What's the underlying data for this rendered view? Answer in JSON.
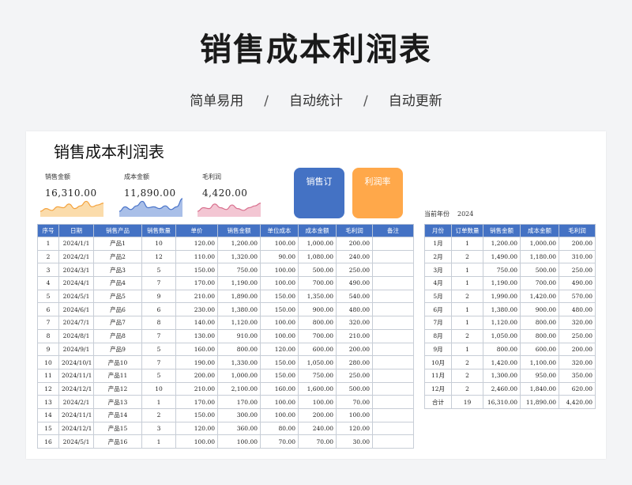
{
  "header": {
    "title": "销售成本利润表",
    "tags": [
      "简单易用",
      "自动统计",
      "自动更新"
    ],
    "separator": "/"
  },
  "sheet": {
    "title": "销售成本利润表",
    "kpis": [
      {
        "label": "销售金额",
        "value": "16,310.00",
        "color": "#f4a23c",
        "fill": "#fbdcab",
        "trend": [
          0.3,
          0.45,
          0.35,
          0.55,
          0.5,
          0.7,
          0.45,
          0.6,
          0.85,
          0.55,
          0.65,
          0.75
        ]
      },
      {
        "label": "成本金额",
        "value": "11,890.00",
        "color": "#4a74c9",
        "fill": "#a9bfe8",
        "trend": [
          0.3,
          0.55,
          0.4,
          0.6,
          0.85,
          0.5,
          0.55,
          0.45,
          0.6,
          0.4,
          0.55,
          1.0
        ]
      },
      {
        "label": "毛利润",
        "value": "4,420.00",
        "color": "#d8708e",
        "fill": "#f3c6d3",
        "trend": [
          0.3,
          0.5,
          0.45,
          0.7,
          0.5,
          0.4,
          0.65,
          0.45,
          0.35,
          0.5,
          0.6,
          0.75
        ]
      }
    ],
    "tiles": [
      {
        "label": "销售订",
        "color": "#4472c4"
      },
      {
        "label": "利润率",
        "color": "#ffa84a"
      }
    ],
    "year_label": "当前年份",
    "year_value": "2024"
  },
  "detail_table": {
    "headers": [
      "序号",
      "日期",
      "销售产品",
      "销售数量",
      "单价",
      "销售金额",
      "单位成本",
      "成本金额",
      "毛利润",
      "备注"
    ],
    "rows": [
      [
        "1",
        "2024/1/1",
        "产品1",
        "10",
        "120.00",
        "1,200.00",
        "100.00",
        "1,000.00",
        "200.00",
        ""
      ],
      [
        "2",
        "2024/2/1",
        "产品2",
        "12",
        "110.00",
        "1,320.00",
        "90.00",
        "1,080.00",
        "240.00",
        ""
      ],
      [
        "3",
        "2024/3/1",
        "产品3",
        "5",
        "150.00",
        "750.00",
        "100.00",
        "500.00",
        "250.00",
        ""
      ],
      [
        "4",
        "2024/4/1",
        "产品4",
        "7",
        "170.00",
        "1,190.00",
        "100.00",
        "700.00",
        "490.00",
        ""
      ],
      [
        "5",
        "2024/5/1",
        "产品5",
        "9",
        "210.00",
        "1,890.00",
        "150.00",
        "1,350.00",
        "540.00",
        ""
      ],
      [
        "6",
        "2024/6/1",
        "产品6",
        "6",
        "230.00",
        "1,380.00",
        "150.00",
        "900.00",
        "480.00",
        ""
      ],
      [
        "7",
        "2024/7/1",
        "产品7",
        "8",
        "140.00",
        "1,120.00",
        "100.00",
        "800.00",
        "320.00",
        ""
      ],
      [
        "8",
        "2024/8/1",
        "产品8",
        "7",
        "130.00",
        "910.00",
        "100.00",
        "700.00",
        "210.00",
        ""
      ],
      [
        "9",
        "2024/9/1",
        "产品9",
        "5",
        "160.00",
        "800.00",
        "120.00",
        "600.00",
        "200.00",
        ""
      ],
      [
        "10",
        "2024/10/1",
        "产品10",
        "7",
        "190.00",
        "1,330.00",
        "150.00",
        "1,050.00",
        "280.00",
        ""
      ],
      [
        "11",
        "2024/11/1",
        "产品11",
        "5",
        "200.00",
        "1,000.00",
        "150.00",
        "750.00",
        "250.00",
        ""
      ],
      [
        "12",
        "2024/12/1",
        "产品12",
        "10",
        "210.00",
        "2,100.00",
        "160.00",
        "1,600.00",
        "500.00",
        ""
      ],
      [
        "13",
        "2024/2/1",
        "产品13",
        "1",
        "170.00",
        "170.00",
        "100.00",
        "100.00",
        "70.00",
        ""
      ],
      [
        "14",
        "2024/11/1",
        "产品14",
        "2",
        "150.00",
        "300.00",
        "100.00",
        "200.00",
        "100.00",
        ""
      ],
      [
        "15",
        "2024/12/1",
        "产品15",
        "3",
        "120.00",
        "360.00",
        "80.00",
        "240.00",
        "120.00",
        ""
      ],
      [
        "16",
        "2024/5/1",
        "产品16",
        "1",
        "100.00",
        "100.00",
        "70.00",
        "70.00",
        "30.00",
        ""
      ]
    ]
  },
  "summary_table": {
    "headers": [
      "月份",
      "订单数量",
      "销售金额",
      "成本金额",
      "毛利润"
    ],
    "rows": [
      [
        "1月",
        "1",
        "1,200.00",
        "1,000.00",
        "200.00"
      ],
      [
        "2月",
        "2",
        "1,490.00",
        "1,180.00",
        "310.00"
      ],
      [
        "3月",
        "1",
        "750.00",
        "500.00",
        "250.00"
      ],
      [
        "4月",
        "1",
        "1,190.00",
        "700.00",
        "490.00"
      ],
      [
        "5月",
        "2",
        "1,990.00",
        "1,420.00",
        "570.00"
      ],
      [
        "6月",
        "1",
        "1,380.00",
        "900.00",
        "480.00"
      ],
      [
        "7月",
        "1",
        "1,120.00",
        "800.00",
        "320.00"
      ],
      [
        "8月",
        "2",
        "1,050.00",
        "800.00",
        "250.00"
      ],
      [
        "9月",
        "1",
        "800.00",
        "600.00",
        "200.00"
      ],
      [
        "10月",
        "2",
        "1,420.00",
        "1,100.00",
        "320.00"
      ],
      [
        "11月",
        "2",
        "1,300.00",
        "950.00",
        "350.00"
      ],
      [
        "12月",
        "2",
        "2,460.00",
        "1,840.00",
        "620.00"
      ],
      [
        "合计",
        "19",
        "16,310.00",
        "11,890.00",
        "4,420.00"
      ]
    ]
  }
}
